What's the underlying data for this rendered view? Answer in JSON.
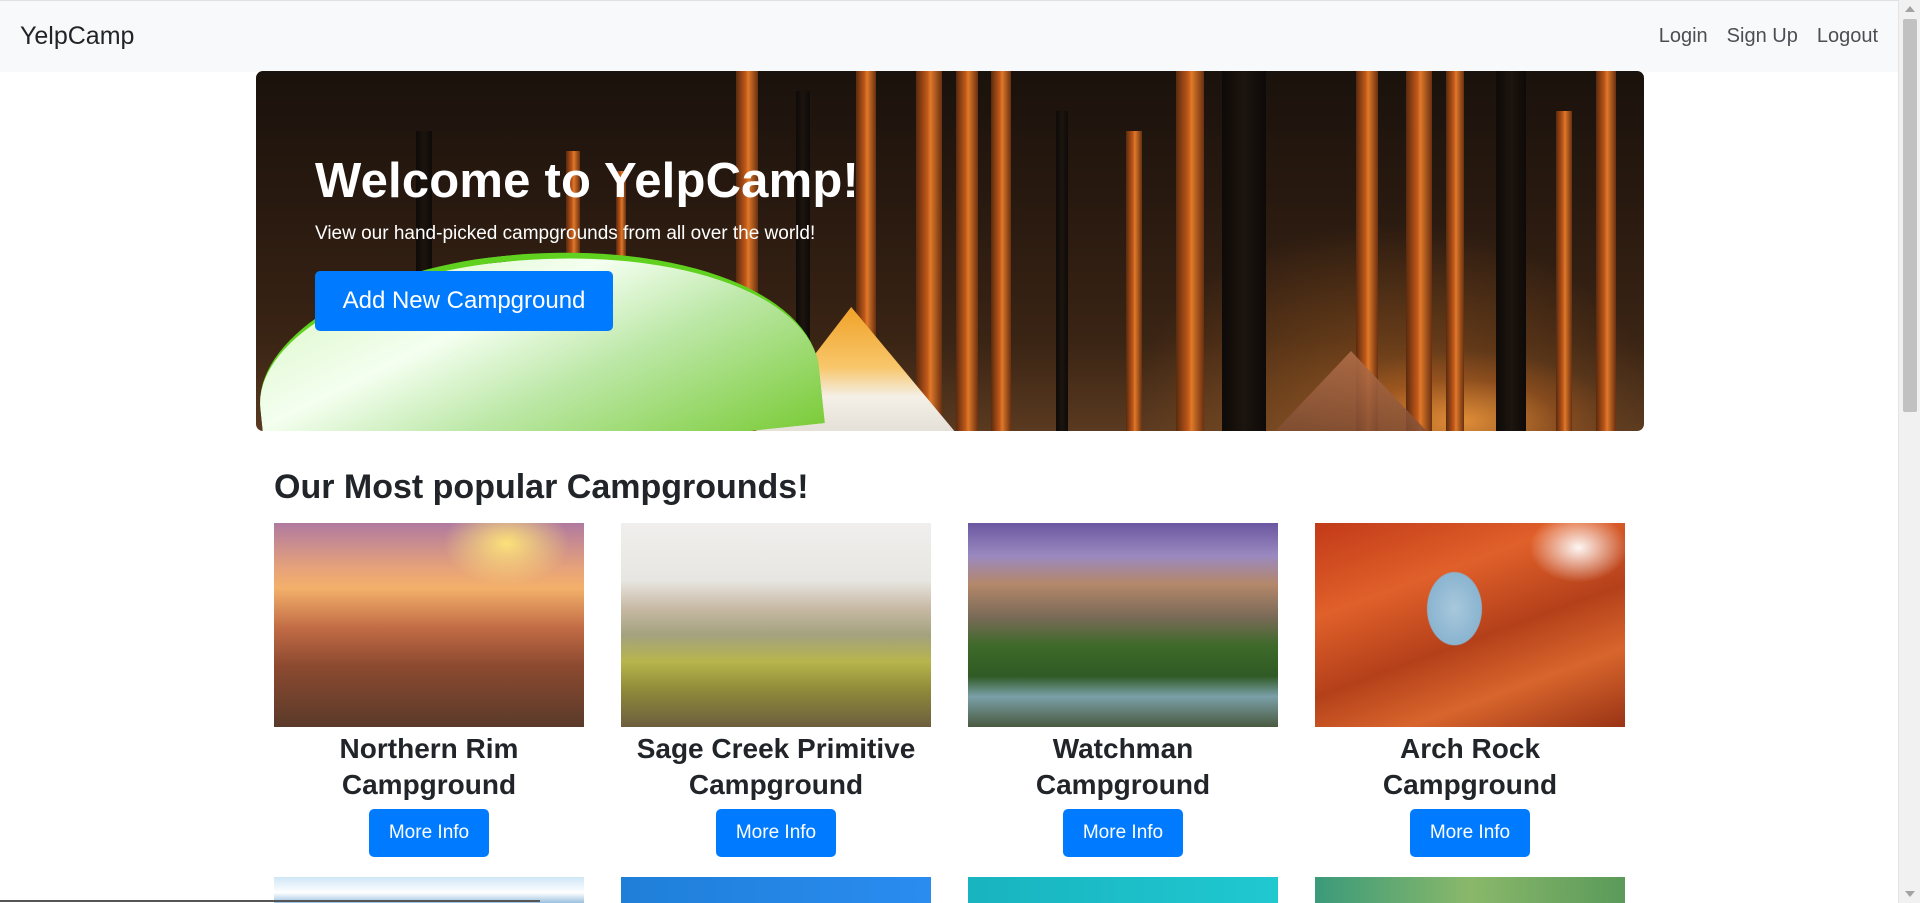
{
  "navbar": {
    "brand": "YelpCamp",
    "links": [
      "Login",
      "Sign Up",
      "Logout"
    ]
  },
  "hero": {
    "title": "Welcome to YelpCamp!",
    "subtitle": "View our hand-picked campgrounds from all over the world!",
    "button_label": "Add New Campground"
  },
  "section": {
    "title": "Our Most popular Campgrounds!"
  },
  "campgrounds": [
    {
      "name_line1": "Northern Rim",
      "name_line2": "Campground",
      "button": "More Info"
    },
    {
      "name_line1": "Sage Creek Primitive",
      "name_line2": "Campground",
      "button": "More Info"
    },
    {
      "name_line1": "Watchman",
      "name_line2": "Campground",
      "button": "More Info"
    },
    {
      "name_line1": "Arch Rock",
      "name_line2": "Campground",
      "button": "More Info"
    }
  ],
  "colors": {
    "primary": "#007bff",
    "navbar_bg": "#f8f9fa",
    "text": "#212529"
  }
}
